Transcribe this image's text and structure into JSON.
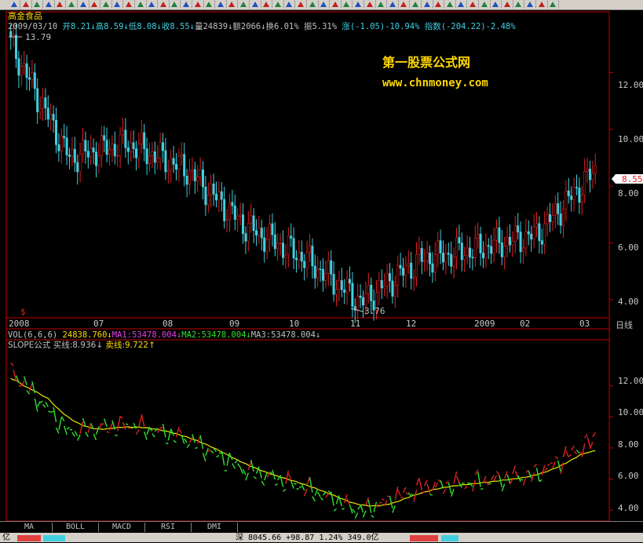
{
  "app": {
    "stock_name": "高金食品",
    "watermark_title": "第一股票公式网",
    "watermark_url": "www.chnmoney.com",
    "signal_mark": "$"
  },
  "header": {
    "date": "2009/03/10",
    "open": "开8.21↓",
    "high": "高8.59↓",
    "low": "低8.08↓",
    "close": "收8.55↓",
    "volume": "量24839↓",
    "amount": "额2066↓",
    "turnover": "换6.01%",
    "amplitude": "振5.31%",
    "change": "涨(-1.05)-10.94%",
    "index": "指数(-204.22)-2.48%"
  },
  "price_chart": {
    "max_label": "13.79",
    "min_label": "3.76",
    "current_price": "8.55",
    "period_label": "日线",
    "y_ticks": [
      "12.00",
      "10.00",
      "8.00",
      "6.00",
      "4.00"
    ],
    "x_ticks": [
      "2008",
      "07",
      "08",
      "09",
      "10",
      "11",
      "12",
      "2009",
      "02",
      "03"
    ]
  },
  "vol_header": {
    "label": "VOL(6,6,6)",
    "vol": "24838.760↓",
    "ma1": "MA1:53478.004↓",
    "ma2": "MA2:53478.004↓",
    "ma3": "MA3:53478.004↓"
  },
  "slope_header": {
    "label": "SLOPE公式",
    "buy": "买线:8.936↓",
    "sell": "卖线:9.722↑"
  },
  "slope_chart": {
    "y_ticks": [
      "12.00",
      "10.00",
      "8.00",
      "6.00",
      "4.00"
    ]
  },
  "tabs": [
    "MA",
    "BOLL",
    "MACD",
    "RSI",
    "DMI"
  ],
  "status": {
    "left": "亿",
    "index_line": "深 8045.66 +98.87 1.24% 349.0亿"
  },
  "colors": {
    "up": "#e02020",
    "down": "#40d0e0",
    "buy_line": "#30e030",
    "sell_line": "#e02020",
    "avg_line": "#e8e800",
    "frame": "#c00000",
    "watermark": "#ffd800"
  },
  "chart_data": {
    "type": "candlestick",
    "price_points": [
      {
        "x": "2008-05",
        "close": 13.0
      },
      {
        "x": "2008-06",
        "close": 9.0
      },
      {
        "x": "2008-07",
        "close": 9.5
      },
      {
        "x": "2008-08",
        "close": 8.6
      },
      {
        "x": "2008-09",
        "close": 6.6
      },
      {
        "x": "2008-10",
        "close": 5.5
      },
      {
        "x": "2008-11",
        "close": 3.9
      },
      {
        "x": "2008-12",
        "close": 5.4
      },
      {
        "x": "2009-01",
        "close": 5.8
      },
      {
        "x": "2009-02",
        "close": 6.3
      },
      {
        "x": "2009-03",
        "close": 8.55
      }
    ],
    "price_max": 13.79,
    "price_min": 3.76,
    "ylim": [
      3.5,
      14.0
    ],
    "x_ticks": [
      "2008",
      "07",
      "08",
      "09",
      "10",
      "11",
      "12",
      "2009",
      "02",
      "03"
    ],
    "slope_buy": 8.936,
    "slope_sell": 9.722
  }
}
